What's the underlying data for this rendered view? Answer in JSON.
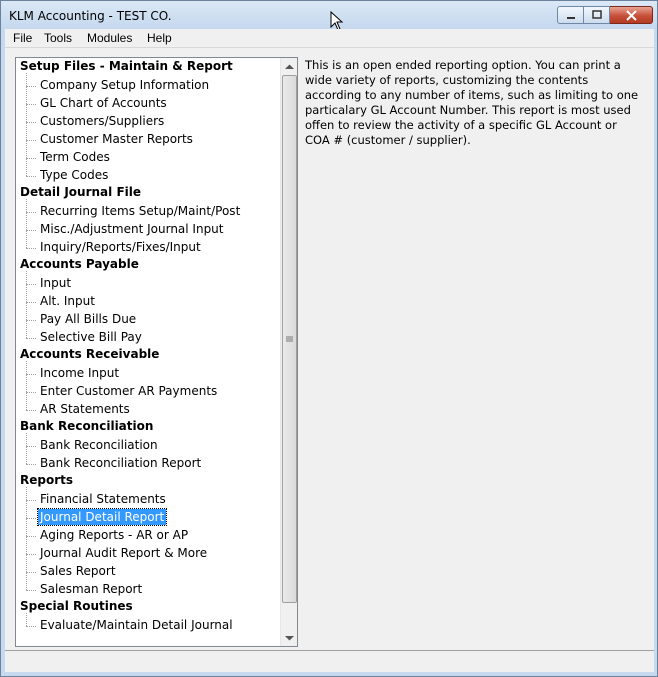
{
  "window": {
    "title": "KLM Accounting - TEST CO.",
    "controls": {
      "minimize": "minimize",
      "maximize": "maximize",
      "close": "close"
    }
  },
  "menubar": {
    "items": [
      "File",
      "Tools",
      "Modules",
      "Help"
    ]
  },
  "tree": {
    "selected_item": "Journal Detail Report",
    "categories": [
      {
        "label": "Setup Files - Maintain & Report",
        "items": [
          "Company Setup Information",
          "GL Chart of Accounts",
          "Customers/Suppliers",
          "Customer Master Reports",
          "Term Codes",
          "Type Codes"
        ]
      },
      {
        "label": "Detail Journal File",
        "items": [
          "Recurring Items Setup/Maint/Post",
          "Misc./Adjustment Journal Input",
          "Inquiry/Reports/Fixes/Input"
        ]
      },
      {
        "label": "Accounts Payable",
        "items": [
          "Input",
          "Alt. Input",
          "Pay All Bills Due",
          "Selective Bill Pay"
        ]
      },
      {
        "label": "Accounts Receivable",
        "items": [
          "Income Input",
          "Enter Customer AR Payments",
          "AR Statements"
        ]
      },
      {
        "label": "Bank Reconciliation",
        "items": [
          "Bank Reconciliation",
          "Bank Reconciliation Report"
        ]
      },
      {
        "label": "Reports",
        "items": [
          "Financial Statements",
          "Journal Detail Report",
          "Aging Reports - AR or AP",
          "Journal Audit Report & More",
          "Sales Report",
          "Salesman Report"
        ]
      },
      {
        "label": "Special Routines",
        "items": [
          "Evaluate/Maintain Detail Journal"
        ]
      }
    ]
  },
  "description": {
    "text": "This is an open ended reporting option. You can print a wide variety of reports, customizing the contents according to any number of items, such as limiting to one particalary GL Account Number. This report is most used offen to review the activity of a specific GL Account or COA # (customer / supplier)."
  },
  "colors": {
    "selection": "#3399ff",
    "titlebar": "#c6d9ee",
    "close_button": "#c7503a"
  }
}
